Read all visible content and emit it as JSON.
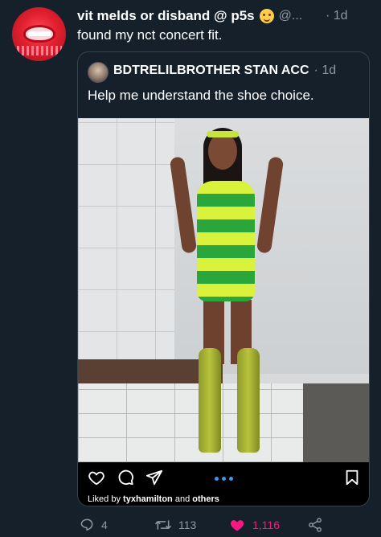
{
  "tweet": {
    "display_name": "vit melds or disband @ p5s",
    "handle": "@...",
    "time": "· 1d",
    "text": "found my nct concert fit."
  },
  "quote": {
    "display_name": "BDTRELILBROTHER STAN ACC",
    "time": "· 1d",
    "text": "Help me understand the shoe choice."
  },
  "instagram": {
    "liked_prefix": "Liked by",
    "liked_user": "tyxhamilton",
    "liked_and": "and",
    "liked_others": "others"
  },
  "actions": {
    "replies": "4",
    "retweets": "113",
    "likes": "1,116"
  },
  "colors": {
    "background": "#15202b",
    "muted": "#8b98a5",
    "like": "#f91880",
    "border": "#38444d"
  }
}
